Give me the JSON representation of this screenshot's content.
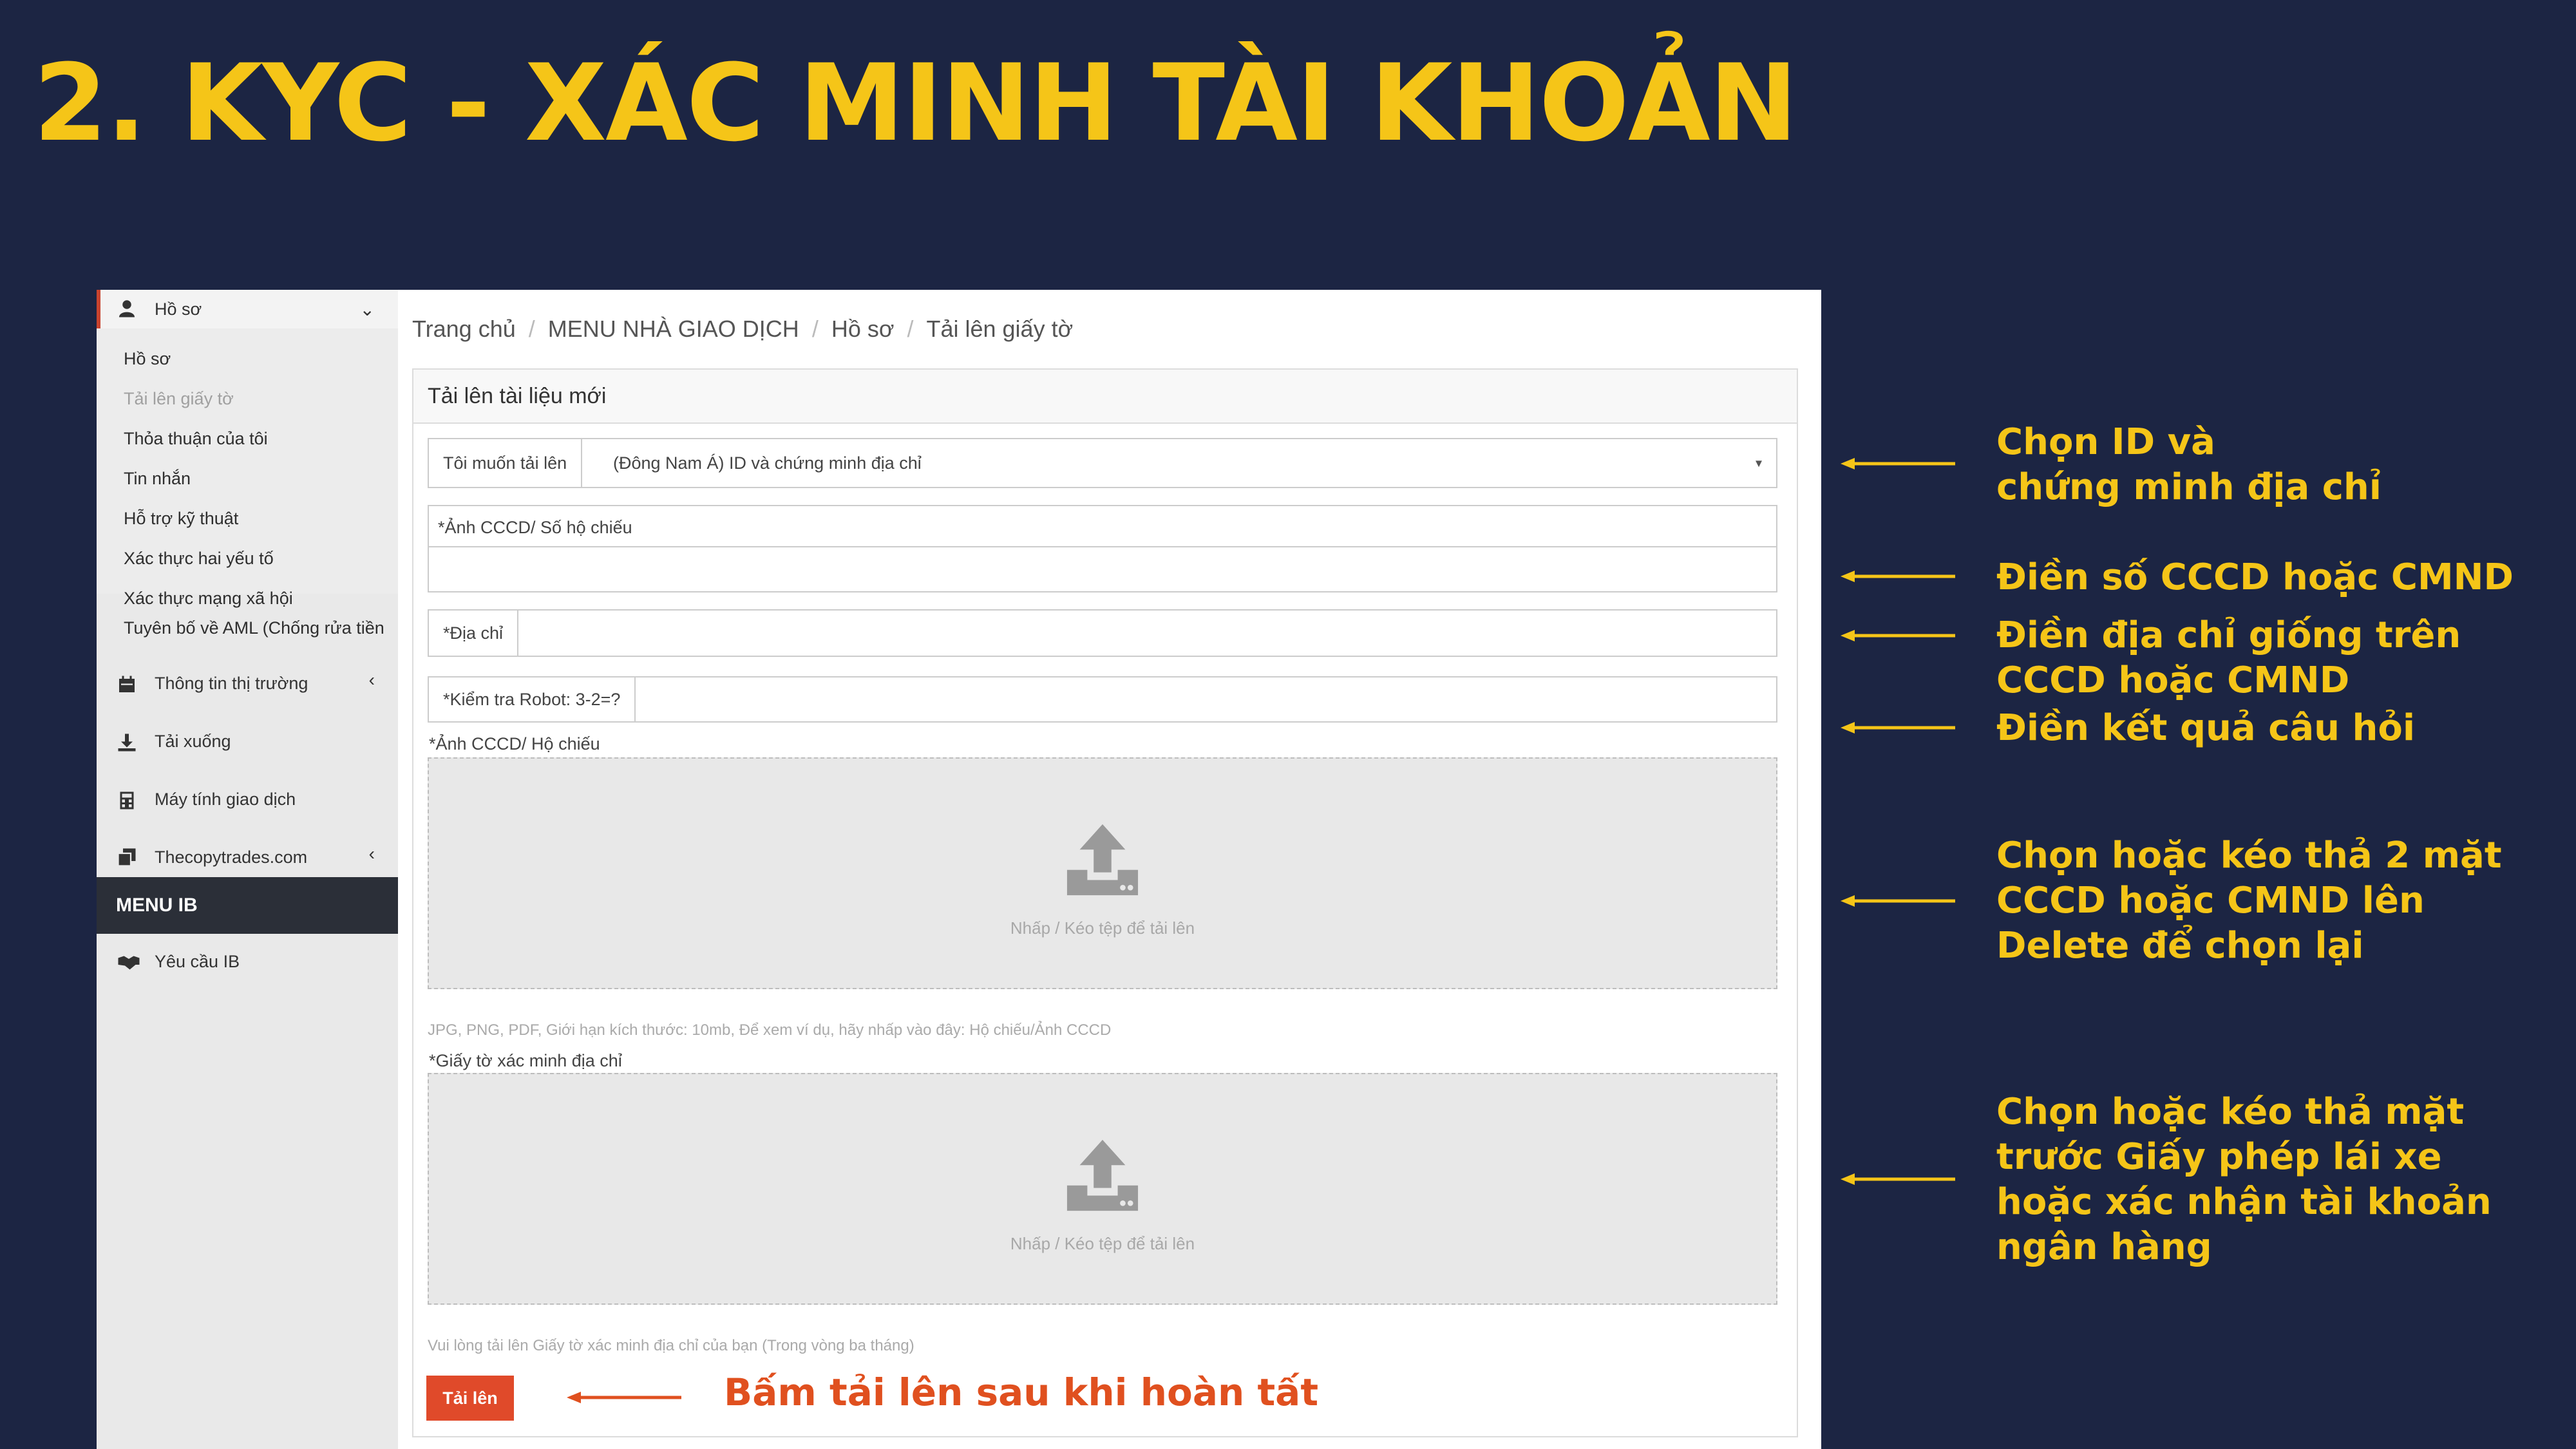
{
  "slide": {
    "title": "2. KYC - XÁC MINH TÀI KHOẢN"
  },
  "sidebar": {
    "profile": {
      "label": "Hồ sơ",
      "icon": "user-icon"
    },
    "sub_items": [
      {
        "label": "Hồ sơ"
      },
      {
        "label": "Tải lên giấy tờ"
      },
      {
        "label": "Thỏa thuận của tôi"
      },
      {
        "label": "Tin nhắn"
      },
      {
        "label": "Hỗ trợ kỹ thuật"
      },
      {
        "label": "Xác thực hai yếu tố"
      },
      {
        "label": "Xác thực mạng xã hội"
      },
      {
        "label": "Tuyên bố về AML (Chống rửa tiền"
      }
    ],
    "items": [
      {
        "label": "Thông tin thị trường",
        "icon": "calendar-icon"
      },
      {
        "label": "Tải xuống",
        "icon": "download-icon"
      },
      {
        "label": "Máy tính giao dịch",
        "icon": "calculator-icon"
      },
      {
        "label": "Thecopytrades.com",
        "icon": "copy-icon"
      }
    ],
    "ib_header": "MENU IB",
    "ib_items": [
      {
        "label": "Yêu cầu IB",
        "icon": "handshake-icon"
      }
    ]
  },
  "breadcrumb": [
    "Trang chủ",
    "MENU NHÀ GIAO DỊCH",
    "Hồ sơ",
    "Tải lên giấy tờ"
  ],
  "form": {
    "panel_title": "Tải lên tài liệu mới",
    "upload_type_label": "Tôi muốn tải lên",
    "upload_type_value": "(Đông Nam Á) ID và chứng minh địa chỉ",
    "id_number_label": "*Ảnh CCCD/ Số hộ chiếu",
    "id_number_value": "",
    "address_label": "*Địa chỉ",
    "address_value": "",
    "captcha_label": "*Kiểm tra Robot: 3-2=?",
    "captcha_value": "",
    "id_photo_label": "*Ảnh CCCD/ Hộ chiếu",
    "dropzone_text": "Nhấp / Kéo tệp để tải lên",
    "id_photo_hint": "JPG, PNG, PDF, Giới hạn kích thước: 10mb, Để xem ví dụ, hãy nhấp vào đây: Hộ chiếu/Ảnh CCCD",
    "address_doc_label": "*Giấy tờ xác minh địa chỉ",
    "address_doc_hint": "Vui lòng tải lên Giấy tờ xác minh địa chỉ của bạn (Trong vòng ba tháng)",
    "submit_label": "Tải lên"
  },
  "annotations": [
    "Chọn ID và\nchứng minh địa chỉ",
    "Điền số CCCD hoặc CMND",
    "Điền địa chỉ giống trên\nCCCD hoặc CMND",
    "Điền kết quả câu hỏi",
    "Chọn hoặc kéo thả 2 mặt\nCCCD hoặc CMND lên\nDelete để chọn lại",
    "Chọn hoặc kéo thả mặt\ntrước Giấy phép lái xe\nhoặc xác nhận tài khoản\nngân hàng"
  ],
  "submit_annotation": "Bấm tải lên sau khi hoàn tất",
  "colors": {
    "background": "#1c2543",
    "accent_yellow": "#f5c518",
    "button_red": "#e04a2a"
  }
}
